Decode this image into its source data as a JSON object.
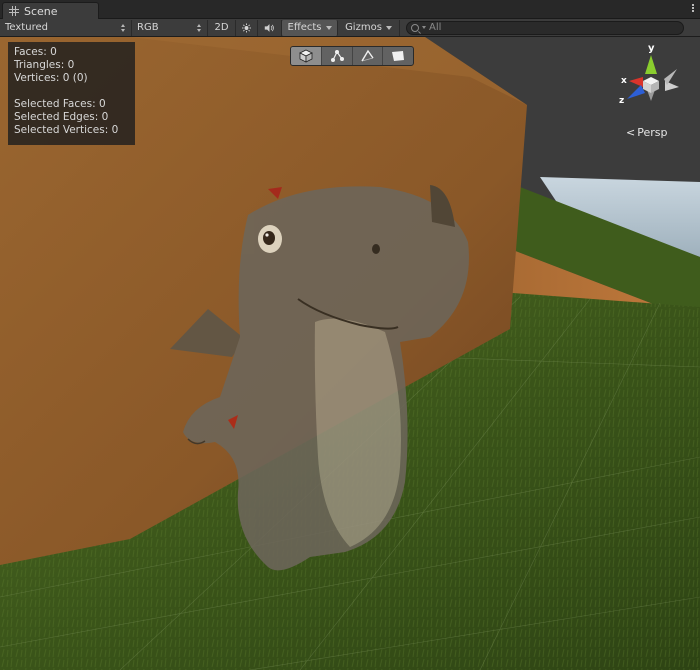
{
  "tab": {
    "title": "Scene",
    "icon": "grid-icon"
  },
  "toolbar": {
    "draw_mode": "Textured",
    "render_mode": "RGB",
    "btn_2d": "2D",
    "lighting_icon": "sun-icon",
    "audio_icon": "speaker-icon",
    "effects_label": "Effects",
    "gizmos_label": "Gizmos",
    "search_placeholder": "All"
  },
  "stats": {
    "faces": "Faces: 0",
    "triangles": "Triangles: 0",
    "vertices": "Vertices: 0 (0)",
    "selected_faces": "Selected Faces: 0",
    "selected_edges": "Selected Edges: 0",
    "selected_vertices": "Selected Vertices: 0"
  },
  "selection_modes": [
    {
      "name": "object-mode",
      "icon": "cube-icon",
      "active": true
    },
    {
      "name": "vertex-mode",
      "icon": "vertex-icon",
      "active": false
    },
    {
      "name": "edge-mode",
      "icon": "edge-icon",
      "active": false
    },
    {
      "name": "face-mode",
      "icon": "face-icon",
      "active": false
    }
  ],
  "gizmo": {
    "x_label": "x",
    "y_label": "y",
    "z_label": "z"
  },
  "projection": {
    "label": "Persp"
  },
  "colors": {
    "ground": "#3d5a1d",
    "box": "#8a5a2c",
    "sky": "#b8c8d4",
    "character": "#6e675a",
    "gizmo_x": "#d9342b",
    "gizmo_y": "#8acd2e",
    "gizmo_z": "#2d5fd6"
  }
}
